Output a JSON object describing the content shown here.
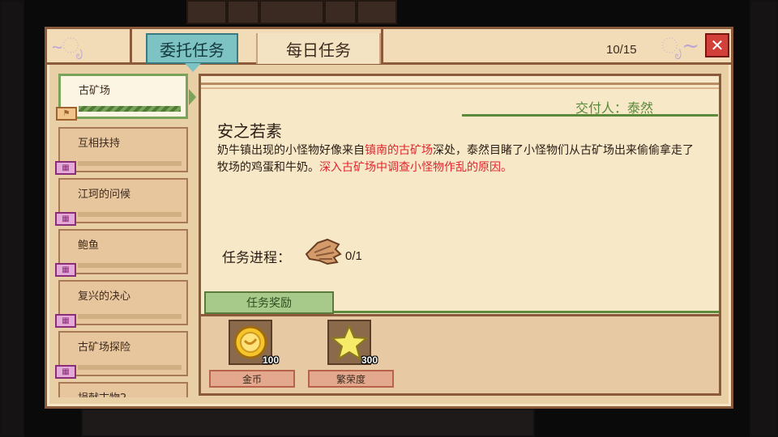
{
  "header": {
    "tabs": [
      {
        "label": "委托任务",
        "active": true
      },
      {
        "label": "每日任务",
        "active": false
      }
    ],
    "count": "10/15",
    "close_icon": "close-icon"
  },
  "quest_list": [
    {
      "label": "古矿场",
      "selected": true,
      "badge": "flag-icon"
    },
    {
      "label": "互相扶持",
      "selected": false,
      "badge": "calendar-icon"
    },
    {
      "label": "江珂的问候",
      "selected": false,
      "badge": "calendar-icon"
    },
    {
      "label": "鲍鱼",
      "selected": false,
      "badge": "calendar-icon"
    },
    {
      "label": "复兴的决心",
      "selected": false,
      "badge": "calendar-icon"
    },
    {
      "label": "古矿场探险",
      "selected": false,
      "badge": "calendar-icon"
    },
    {
      "label": "捐献古物2",
      "selected": false,
      "badge": "calendar-icon"
    }
  ],
  "detail": {
    "giver": "交付人：泰然",
    "title": "安之若素",
    "desc_parts": [
      {
        "text": "奶牛镇出现的小怪物好像来自",
        "highlight": false
      },
      {
        "text": "镇南的古矿场",
        "highlight": true
      },
      {
        "text": "深处，泰然目睹了小怪物们从古矿场出来偷偷拿走了牧场的鸡蛋和牛奶。",
        "highlight": false
      },
      {
        "text": "深入古矿场中调查小怪物作乱的原因。",
        "highlight": true
      }
    ],
    "progress_label": "任务进程：",
    "progress_value": "0/1",
    "progress_icon": "wing-item-icon",
    "highlight_color": "#e0262e"
  },
  "rewards": {
    "tab_label": "任务奖励",
    "items": [
      {
        "name": "金币",
        "amount": "100",
        "icon": "gold-coin-icon"
      },
      {
        "name": "繁荣度",
        "amount": "300",
        "icon": "star-icon"
      }
    ]
  }
}
